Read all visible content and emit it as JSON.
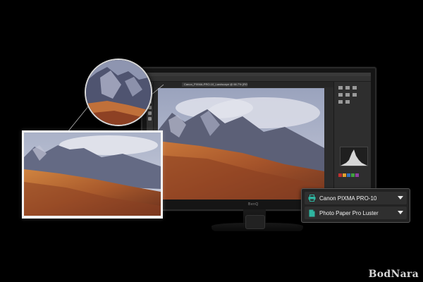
{
  "photoshop": {
    "document_tab": "Canon_PIXMA-PRO-10_Landscape @ 66.7% (RGB/8)",
    "brand": "BenQ"
  },
  "print_dialog": {
    "printer_label": "Canon PIXMA PRO-10",
    "paper_label": "Photo Paper Pro Luster",
    "accent_color": "#2fb5a0"
  },
  "watermark": "BodNara",
  "icons": {
    "printer": "printer-icon",
    "paper": "paper-icon",
    "dropdown": "chevron-down-icon"
  }
}
